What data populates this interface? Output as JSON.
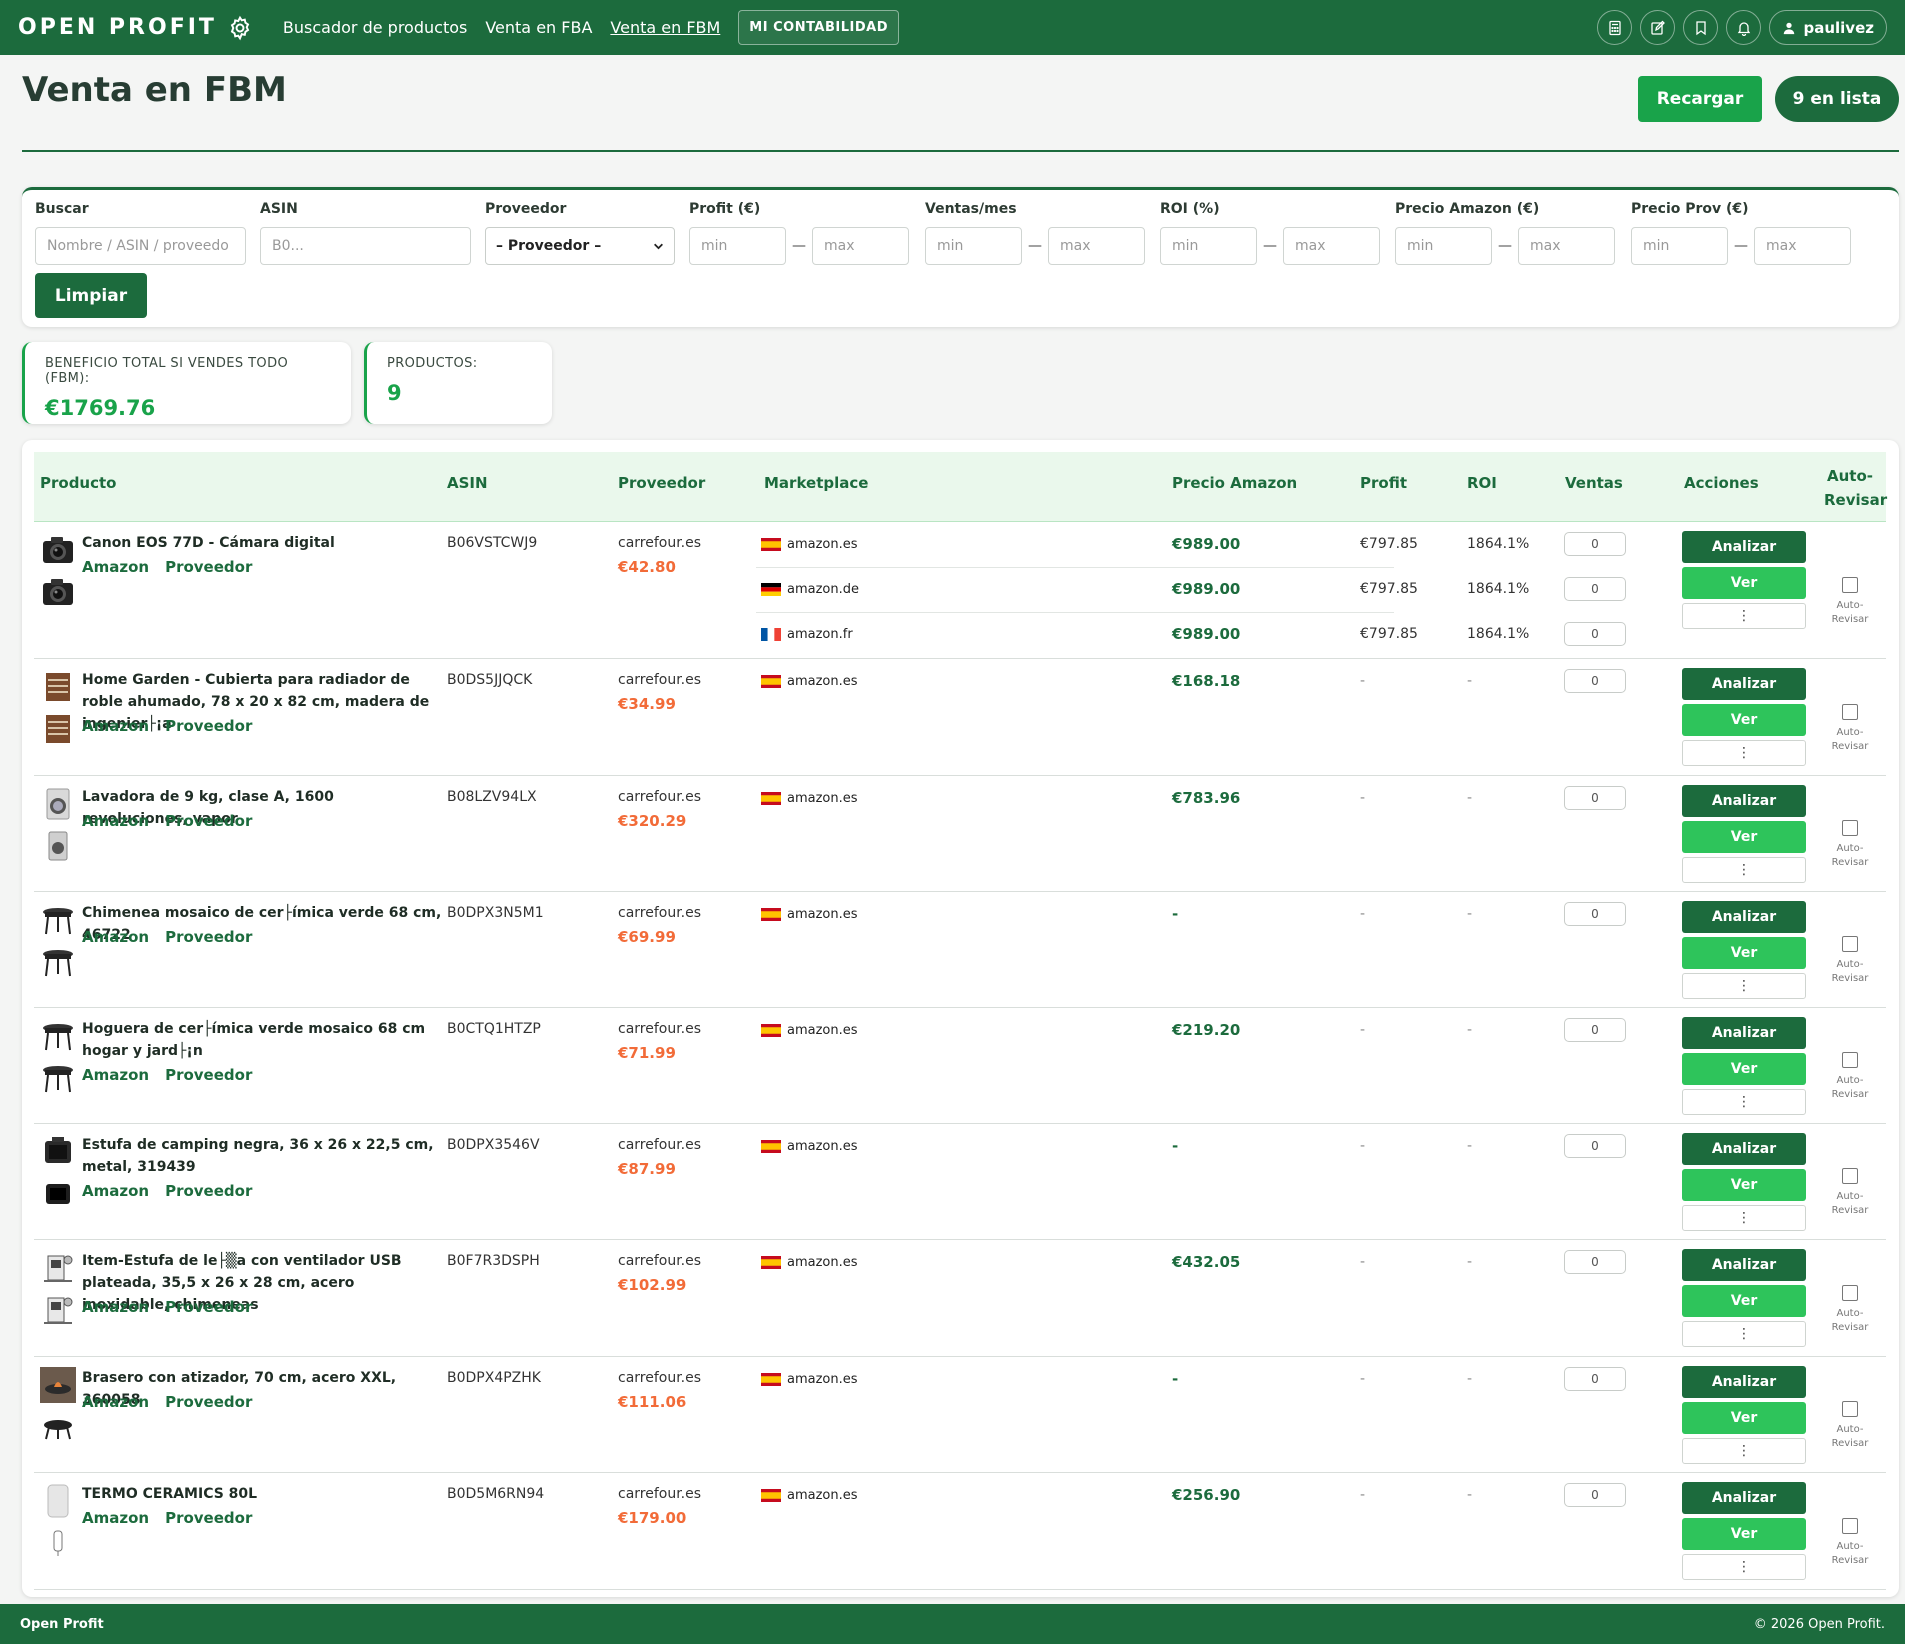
{
  "nav": {
    "brand": "OPEN PROFIT",
    "links": [
      "Buscador de productos",
      "Venta en FBA",
      "Venta en FBM"
    ],
    "accounting": "MI CONTABILIDAD",
    "user": "paulivez"
  },
  "header": {
    "title": "Venta en FBM",
    "reload": "Recargar",
    "list": "9 en lista"
  },
  "filters": {
    "search_label": "Buscar",
    "search_placeholder": "Nombre / ASIN / proveedo",
    "asin_label": "ASIN",
    "asin_placeholder": "B0...",
    "provider_label": "Proveedor",
    "provider_value": "– Proveedor –",
    "profit_label": "Profit (€)",
    "sales_label": "Ventas/mes",
    "roi_label": "ROI (%)",
    "amazon_price_label": "Precio Amazon (€)",
    "prov_price_label": "Precio Prov (€)",
    "min": "min",
    "max": "max",
    "range_sep": "—",
    "clear": "Limpiar"
  },
  "stats": {
    "total_label": "BENEFICIO TOTAL SI VENDES TODO (FBM):",
    "total_value": "€1769.76",
    "products_label": "PRODUCTOS:",
    "products_value": "9"
  },
  "table": {
    "headers": [
      "Producto",
      "ASIN",
      "Proveedor",
      "Marketplace",
      "Precio Amazon",
      "Profit",
      "ROI",
      "Ventas",
      "Acciones",
      "Auto-",
      "Revisar"
    ],
    "link_amazon": "Amazon",
    "link_provider": "Proveedor",
    "btn_analyze": "Analizar",
    "btn_view": "Ver",
    "btn_more": "⋮",
    "auto_label_1": "Auto-",
    "auto_label_2": "Revisar",
    "rows": [
      {
        "name": "Canon EOS 77D - Cámara digital",
        "asin": "B06VSTCWJ9",
        "prov": "carrefour.es",
        "prov_price": "€42.80",
        "markets": [
          {
            "flag": "es",
            "name": "amazon.es",
            "price": "€989.00",
            "profit": "€797.85",
            "roi": "1864.1%",
            "ventas": "0"
          },
          {
            "flag": "de",
            "name": "amazon.de",
            "price": "€989.00",
            "profit": "€797.85",
            "roi": "1864.1%",
            "ventas": "0"
          },
          {
            "flag": "fr",
            "name": "amazon.fr",
            "price": "€989.00",
            "profit": "€797.85",
            "roi": "1864.1%",
            "ventas": "0"
          }
        ]
      },
      {
        "name": "Home Garden - Cubierta para radiador de roble ahumado, 78 x 20 x 82 cm, madera de ingenier├¡a",
        "asin": "B0DS5JJQCK",
        "prov": "carrefour.es",
        "prov_price": "€34.99",
        "markets": [
          {
            "flag": "es",
            "name": "amazon.es",
            "price": "€168.18",
            "profit": "-",
            "roi": "-",
            "ventas": "0"
          }
        ]
      },
      {
        "name": "Lavadora de 9 kg, clase A, 1600 revoluciones, vapor",
        "asin": "B08LZV94LX",
        "prov": "carrefour.es",
        "prov_price": "€320.29",
        "markets": [
          {
            "flag": "es",
            "name": "amazon.es",
            "price": "€783.96",
            "profit": "-",
            "roi": "-",
            "ventas": "0"
          }
        ]
      },
      {
        "name": "Chimenea mosaico de cer├ímica verde 68 cm, 46722",
        "asin": "B0DPX3N5M1",
        "prov": "carrefour.es",
        "prov_price": "€69.99",
        "markets": [
          {
            "flag": "es",
            "name": "amazon.es",
            "price": "-",
            "profit": "-",
            "roi": "-",
            "ventas": "0"
          }
        ]
      },
      {
        "name": "Hoguera de cer├ímica verde mosaico 68 cm hogar y jard├¡n",
        "asin": "B0CTQ1HTZP",
        "prov": "carrefour.es",
        "prov_price": "€71.99",
        "markets": [
          {
            "flag": "es",
            "name": "amazon.es",
            "price": "€219.20",
            "profit": "-",
            "roi": "-",
            "ventas": "0"
          }
        ]
      },
      {
        "name": "Estufa de camping negra, 36 x 26 x 22,5 cm, metal, 319439",
        "asin": "B0DPX3546V",
        "prov": "carrefour.es",
        "prov_price": "€87.99",
        "markets": [
          {
            "flag": "es",
            "name": "amazon.es",
            "price": "-",
            "profit": "-",
            "roi": "-",
            "ventas": "0"
          }
        ]
      },
      {
        "name": "Item-Estufa de le├▒a con ventilador USB plateada, 35,5 x 26 x 28 cm, acero inoxidable, chimeneas",
        "asin": "B0F7R3DSPH",
        "prov": "carrefour.es",
        "prov_price": "€102.99",
        "markets": [
          {
            "flag": "es",
            "name": "amazon.es",
            "price": "€432.05",
            "profit": "-",
            "roi": "-",
            "ventas": "0"
          }
        ]
      },
      {
        "name": "Brasero con atizador, 70 cm, acero XXL, 360058",
        "asin": "B0DPX4PZHK",
        "prov": "carrefour.es",
        "prov_price": "€111.06",
        "markets": [
          {
            "flag": "es",
            "name": "amazon.es",
            "price": "-",
            "profit": "-",
            "roi": "-",
            "ventas": "0"
          }
        ]
      },
      {
        "name": "TERMO CERAMICS 80L",
        "asin": "B0D5M6RN94",
        "prov": "carrefour.es",
        "prov_price": "€179.00",
        "markets": [
          {
            "flag": "es",
            "name": "amazon.es",
            "price": "€256.90",
            "profit": "-",
            "roi": "-",
            "ventas": "0"
          }
        ]
      }
    ]
  },
  "footer": {
    "brand": "Open Profit",
    "copyright": "© 2026 Open Profit."
  }
}
